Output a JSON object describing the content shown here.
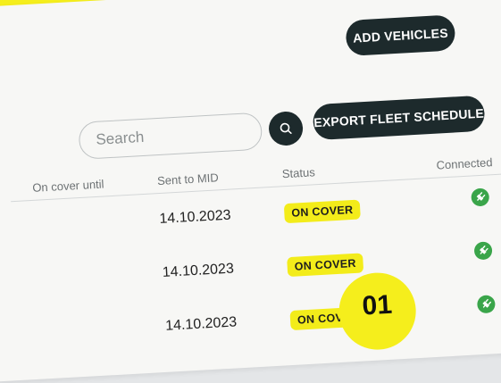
{
  "toolbar": {
    "add_vehicles_label": "ADD VEHICLES",
    "export_label": "EXPORT FLEET SCHEDULE"
  },
  "search": {
    "placeholder": "Search"
  },
  "table": {
    "columns": [
      "On cover until",
      "Sent to MID",
      "Status",
      "Connected"
    ],
    "rows": [
      {
        "sent_to_mid": "14.10.2023",
        "status": "ON COVER",
        "connected": true
      },
      {
        "sent_to_mid": "14.10.2023",
        "status": "ON COVER",
        "connected": true
      },
      {
        "sent_to_mid": "14.10.2023",
        "status": "ON COVER",
        "connected": true
      }
    ]
  },
  "page_badge": "01",
  "colors": {
    "accent": "#f5ee1c",
    "button_dark": "#1d2a2c",
    "status_yellow": "#f3ec1a",
    "connected_green": "#3aa54a"
  },
  "icons": {
    "search": "search-icon",
    "connected": "plug-icon"
  }
}
